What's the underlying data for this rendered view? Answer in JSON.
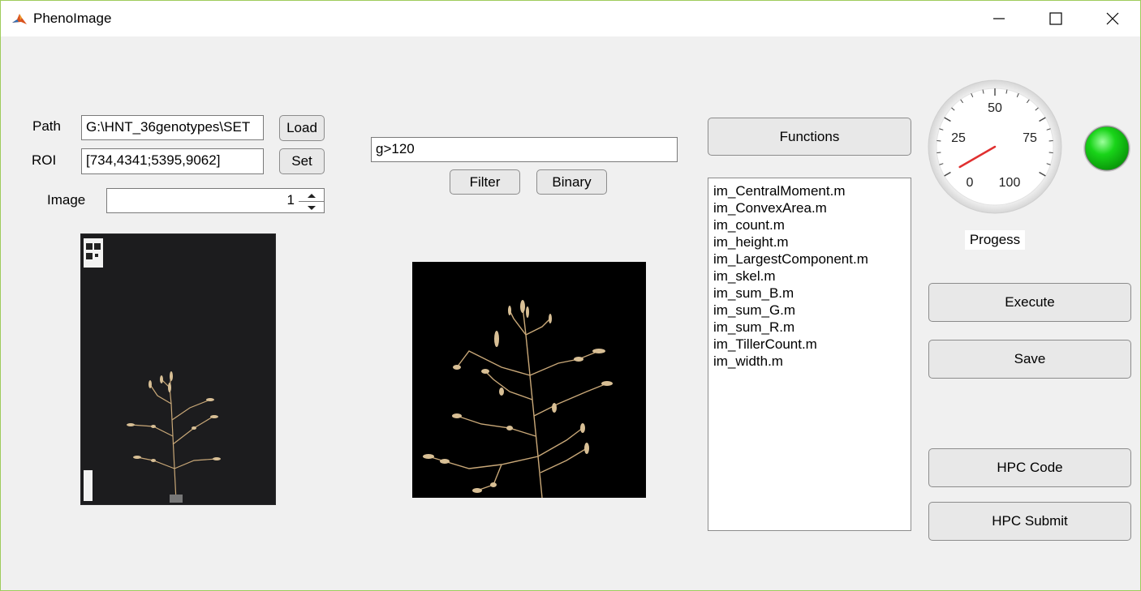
{
  "window": {
    "title": "PhenoImage"
  },
  "form": {
    "path_label": "Path",
    "path_value": "G:\\HNT_36genotypes\\SET",
    "load_label": "Load",
    "roi_label": "ROI",
    "roi_value": "[734,4341;5395,9062]",
    "set_label": "Set",
    "image_label": "Image",
    "image_value": "1"
  },
  "filter": {
    "expression": "g>120",
    "filter_label": "Filter",
    "binary_label": "Binary"
  },
  "functions": {
    "button_label": "Functions",
    "items": [
      "im_CentralMoment.m",
      "im_ConvexArea.m",
      "im_count.m",
      "im_height.m",
      "im_LargestComponent.m",
      "im_skel.m",
      "im_sum_B.m",
      "im_sum_G.m",
      "im_sum_R.m",
      "im_TillerCount.m",
      "im_width.m"
    ]
  },
  "gauge": {
    "ticks": [
      "0",
      "25",
      "50",
      "75",
      "100"
    ],
    "value": 0,
    "label": "Progess"
  },
  "lamp": {
    "color": "#19d419"
  },
  "actions": {
    "execute_label": "Execute",
    "save_label": "Save",
    "hpc_code_label": "HPC Code",
    "hpc_submit_label": "HPC Submit"
  }
}
